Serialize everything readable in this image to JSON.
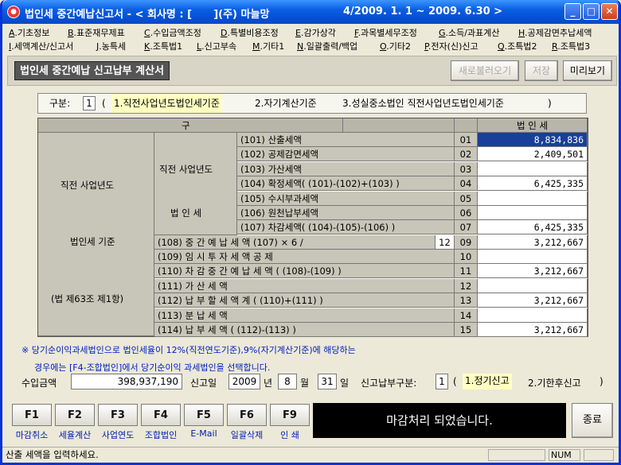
{
  "window": {
    "title": "법인세 중간예납신고서 - < 회사명 : [      ](주) 마늘망",
    "period": "4/2009. 1. 1 ~ 2009. 6.30 >",
    "min": "_",
    "max": "□",
    "close": "✕"
  },
  "menu_row1": [
    {
      "key": "A",
      "label": ".기초정보"
    },
    {
      "key": "B",
      "label": ".표준재무제표"
    },
    {
      "key": "C",
      "label": ".수입금액조정"
    },
    {
      "key": "D",
      "label": ".특별비용조정"
    },
    {
      "key": "E",
      "label": ".감가상각"
    },
    {
      "key": "F",
      "label": ".과목별세무조정"
    },
    {
      "key": "G",
      "label": ".소득/과표계산"
    },
    {
      "key": "H",
      "label": ".공제감면추납세액"
    }
  ],
  "menu_row2": [
    {
      "key": "I",
      "label": ".세액계산/신고서"
    },
    {
      "key": "J",
      "label": ".농특세"
    },
    {
      "key": "K",
      "label": ".조특법1"
    },
    {
      "key": "L",
      "label": ".신고부속"
    },
    {
      "key": "M",
      "label": ".기타1"
    },
    {
      "key": "N",
      "label": ".일괄출력/백업"
    },
    {
      "key": "O",
      "label": ".기타2"
    },
    {
      "key": "P",
      "label": ".전자(신)신고"
    },
    {
      "key": "Q",
      "label": ".조특법2"
    },
    {
      "key": "R",
      "label": ".조특법3"
    }
  ],
  "header": {
    "title": "법인세 중간예납 신고납부 계산서",
    "btn_reload": "새로불러오기",
    "btn_save": "저장",
    "btn_preview": "미리보기"
  },
  "kubun": {
    "label": "구분:",
    "value": "1",
    "open": "(",
    "opt1": "1.직전사업년도법인세기준",
    "opt2": "2.자기계산기준",
    "opt3": "3.성실중소법인 직전사업년도법인세기준",
    "close": ")"
  },
  "table": {
    "col_gu": "구",
    "col_bun": "분",
    "col_tax": "법   인   세",
    "left_group1": "직전 사업년도",
    "left_group2": "법인세 기준",
    "left_group3": "(법 제63조 제1항)",
    "mid_group1": "직전 사업년도",
    "mid_group2": "법 인 세",
    "rows_upper": [
      {
        "label": "(101) 산출세액",
        "code": "01",
        "value": "8,834,836"
      },
      {
        "label": "(102) 공제감면세액",
        "code": "02",
        "value": "2,409,501"
      },
      {
        "label": "(103) 가산세액",
        "code": "03",
        "value": ""
      },
      {
        "label": "(104) 확정세액( (101)-(102)+(103) )",
        "code": "04",
        "value": "6,425,335"
      },
      {
        "label": "(105) 수시부과세액",
        "code": "05",
        "value": ""
      },
      {
        "label": "(106) 원천납부세액",
        "code": "06",
        "value": ""
      },
      {
        "label": "(107) 차감세액( (104)-(105)-(106) )",
        "code": "07",
        "value": "6,425,335"
      }
    ],
    "row108": {
      "label": "(108) 중 간 예 납 세 액   (107) × 6 /",
      "months": "12",
      "code": "09",
      "value": "3,212,667"
    },
    "rows_lower": [
      {
        "label": "(109) 임 시  투 자  세 액 공 제",
        "code": "10",
        "value": ""
      },
      {
        "label": "(110) 차 감  중 간  예 납  세  액 ( (108)-(109) )",
        "code": "11",
        "value": "3,212,667"
      },
      {
        "label": "(111) 가        산        세        액",
        "code": "12",
        "value": ""
      },
      {
        "label": "(112) 납    부    할    세    액    계 ( (110)+(111) )",
        "code": "13",
        "value": "3,212,667"
      },
      {
        "label": "(113) 분        납        세        액",
        "code": "14",
        "value": ""
      },
      {
        "label": "(114) 납        부        세        액 ( (112)-(113) )",
        "code": "15",
        "value": "3,212,667"
      }
    ]
  },
  "notes": {
    "line1": "※ 당기순이익과세법인으로 법인세율이 12%(직전연도기준),9%(자기계산기준)에 해당하는",
    "line2": "경우에는 [F4-조합법인]에서 당기순이익 과세법인을 선택합니다."
  },
  "footer_fields": {
    "revenue_label": "수입금액",
    "revenue_value": "398,937,190",
    "date_label": "신고일",
    "year": "2009",
    "year_unit": "년",
    "month": "8",
    "month_unit": "월",
    "day": "31",
    "day_unit": "일",
    "pay_label": "신고납부구분:",
    "pay_value": "1",
    "pay_open": "(",
    "pay_opt1": "1.정기신고",
    "pay_opt2": "2.기한후신고",
    "pay_close": ")"
  },
  "fkeys": [
    {
      "key": "F1",
      "label": "마감취소"
    },
    {
      "key": "F2",
      "label": "세율계산"
    },
    {
      "key": "F3",
      "label": "사업연도"
    },
    {
      "key": "F4",
      "label": "조합법인"
    },
    {
      "key": "F5",
      "label": "E-Mail"
    },
    {
      "key": "F6",
      "label": "일괄삭제"
    },
    {
      "key": "F9",
      "label": "인 쇄"
    }
  ],
  "message": "마감처리 되었습니다.",
  "exit_label": "종료",
  "statusbar": {
    "text": "산출 세액을 입력하세요.",
    "num": "NUM"
  }
}
